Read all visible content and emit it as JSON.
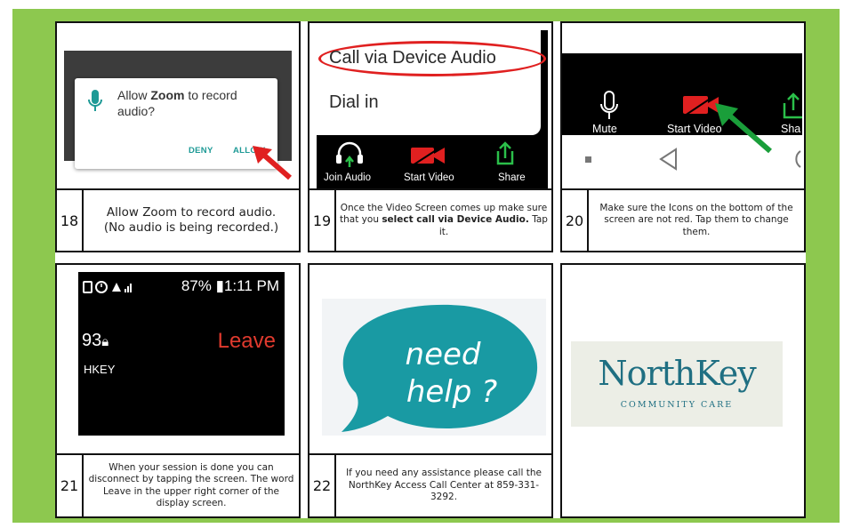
{
  "panel18": {
    "dialog_prefix": "Allow ",
    "dialog_app": "Zoom",
    "dialog_suffix": " to record",
    "dialog_line2": "audio?",
    "deny_label": "DENY",
    "allow_label": "ALLOW",
    "step_number": "18",
    "caption_line1": "Allow Zoom to record audio.",
    "caption_line2": "(No audio is being recorded.)"
  },
  "panel19": {
    "menu_item_1": "Call via Device Audio",
    "menu_item_2": "Dial in",
    "toolbar": [
      "Join Audio",
      "Start Video",
      "Share"
    ],
    "step_number": "19",
    "caption_part1": "Once the Video Screen comes up make sure that you ",
    "caption_bold1": "select call via Device Audio.",
    "caption_part2": "  Tap it."
  },
  "panel20": {
    "toolbar": [
      "Mute",
      "Start Video",
      "Sha"
    ],
    "step_number": "20",
    "caption": "Make sure the Icons on the bottom of the screen are not red. Tap them to change them."
  },
  "panel21": {
    "status_bar": "87% ▮1:11 PM",
    "meeting_id_fragment": "93",
    "name_fragment": "HKEY",
    "leave_label": "Leave",
    "step_number": "21",
    "caption": "When your session is done you can disconnect by tapping the screen. The word Leave in the upper right corner of the display screen."
  },
  "panel22": {
    "bubble_line1": "need",
    "bubble_line2": "help ?",
    "step_number": "22",
    "caption": "If you need any assistance please call the NorthKey Access Call Center at 859-331-3292."
  },
  "panel23": {
    "logo_name": "NorthKey",
    "logo_subtitle": "COMMUNITY CARE"
  },
  "colors": {
    "frame_green": "#8dc84f",
    "teal": "#1e9a96",
    "alert_red": "#e02020",
    "arrow_green": "#1a9e3a",
    "logo_blue": "#1f6f82"
  }
}
